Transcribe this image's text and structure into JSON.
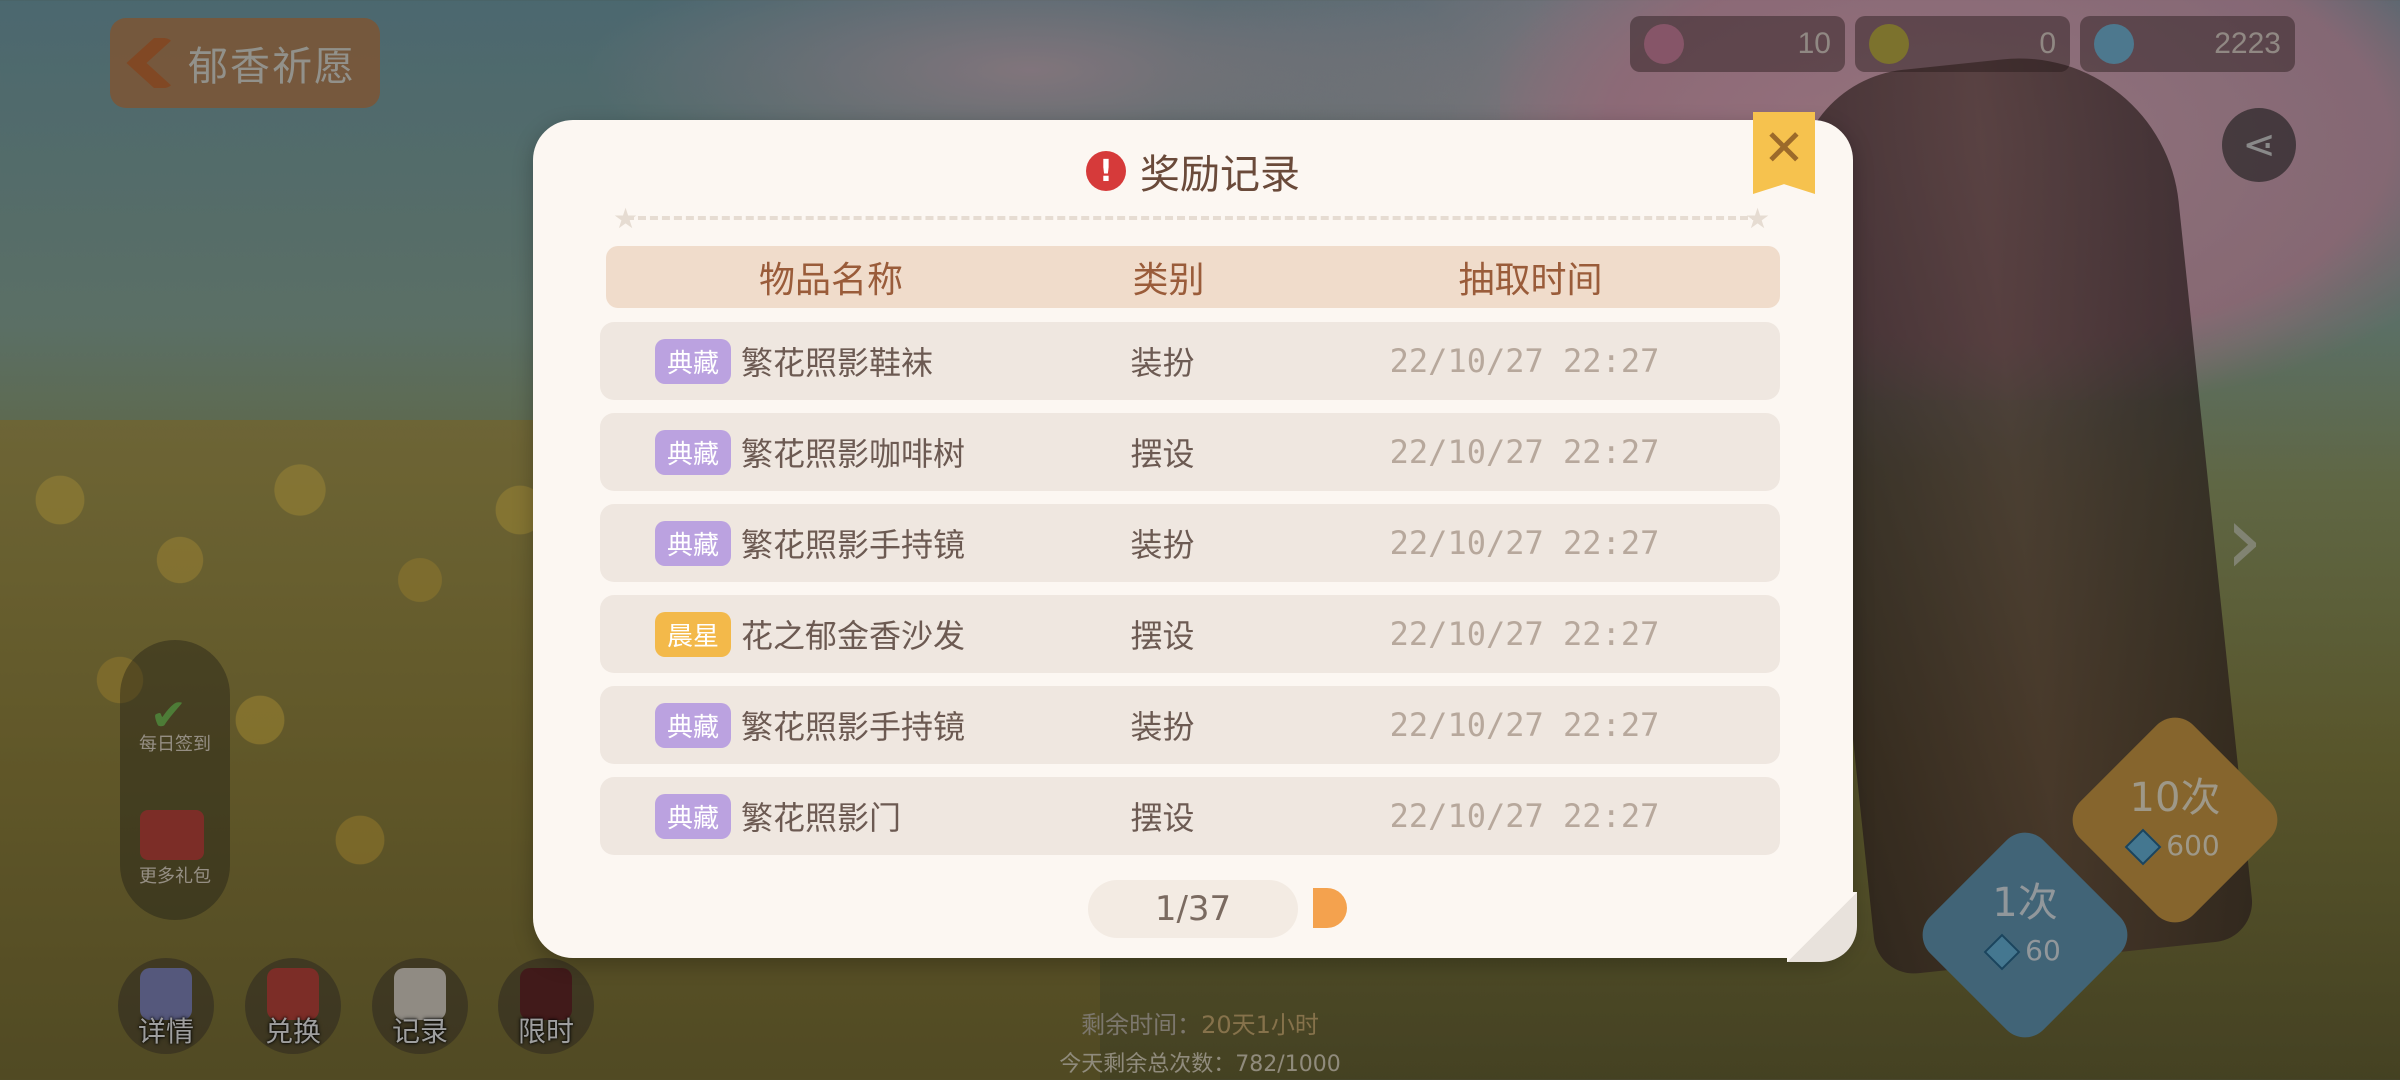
{
  "header": {
    "title": "郁香祈愿"
  },
  "currencies": [
    {
      "icon": "flower-ticket-icon",
      "value": "10"
    },
    {
      "icon": "key-icon",
      "value": "0"
    },
    {
      "icon": "crystal-icon",
      "value": "2223"
    }
  ],
  "side_panel": {
    "check_label": "每日签到",
    "gift_label": "更多礼包"
  },
  "bottom_menu": [
    {
      "label": "详情"
    },
    {
      "label": "兑换"
    },
    {
      "label": "记录"
    },
    {
      "label": "限时"
    }
  ],
  "footer": {
    "remaining_label": "剩余时间：",
    "remaining_value": "20天1小时",
    "energy_text": "今天剩余总次数：782/1000"
  },
  "draw_buttons": {
    "ten": {
      "count": "10次",
      "cost": "600"
    },
    "one": {
      "count": "1次",
      "cost": "60"
    }
  },
  "modal": {
    "title": "奖励记录",
    "columns": [
      "物品名称",
      "类别",
      "抽取时间"
    ],
    "rows": [
      {
        "tag": "典藏",
        "tag_color": "#bba2e0",
        "name": "繁花照影鞋袜",
        "type": "装扮",
        "time": "22/10/27 22:27"
      },
      {
        "tag": "典藏",
        "tag_color": "#bba2e0",
        "name": "繁花照影咖啡树",
        "type": "摆设",
        "time": "22/10/27 22:27"
      },
      {
        "tag": "典藏",
        "tag_color": "#bba2e0",
        "name": "繁花照影手持镜",
        "type": "装扮",
        "time": "22/10/27 22:27"
      },
      {
        "tag": "晨星",
        "tag_color": "#f3b94a",
        "name": "花之郁金香沙发",
        "type": "摆设",
        "time": "22/10/27 22:27"
      },
      {
        "tag": "典藏",
        "tag_color": "#bba2e0",
        "name": "繁花照影手持镜",
        "type": "装扮",
        "time": "22/10/27 22:27"
      },
      {
        "tag": "典藏",
        "tag_color": "#bba2e0",
        "name": "繁花照影门",
        "type": "摆设",
        "time": "22/10/27 22:27"
      }
    ],
    "pager": "1/37"
  }
}
